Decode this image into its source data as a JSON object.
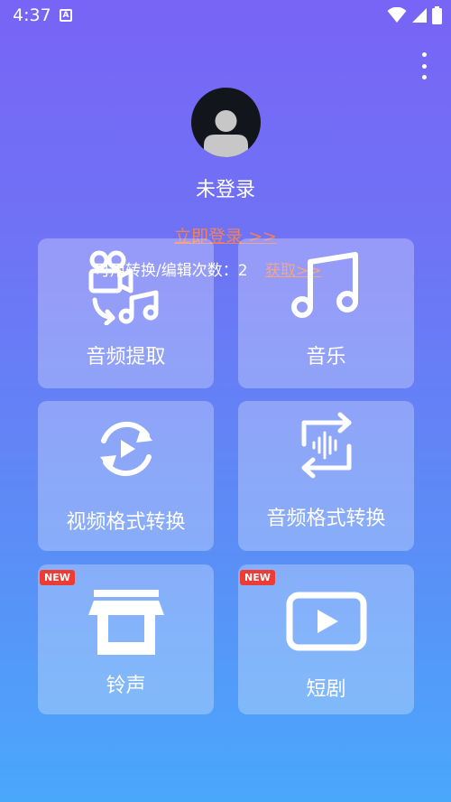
{
  "status": {
    "time": "4:37",
    "notif_letter": "A"
  },
  "profile": {
    "username": "未登录",
    "login_link": "立即登录 >>",
    "usage_text": "可用转换/编辑次数：2",
    "get_more": "获取>>"
  },
  "cards": [
    {
      "label": "音频提取",
      "icon": "video-to-music-icon"
    },
    {
      "label": "音乐",
      "icon": "music-note-icon"
    },
    {
      "label": "视频格式转换",
      "icon": "rotate-play-icon"
    },
    {
      "label": "音频格式转换",
      "icon": "audio-convert-icon"
    },
    {
      "label": "铃声",
      "icon": "store-icon",
      "badge": "NEW"
    },
    {
      "label": "短剧",
      "icon": "play-box-icon",
      "badge": "NEW"
    }
  ],
  "colors": {
    "accent_link": "#f2805a",
    "badge_red": "#ee3b33"
  }
}
